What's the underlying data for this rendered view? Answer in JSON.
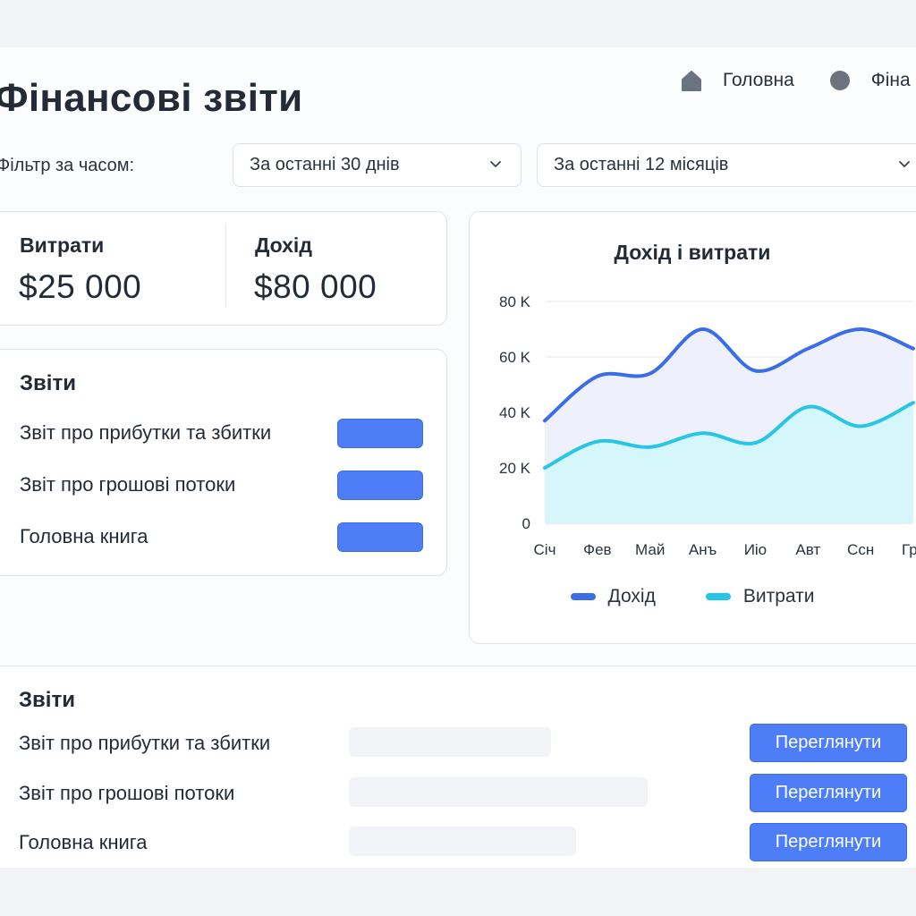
{
  "page_title": "Фінансові звіти",
  "nav": {
    "home_label": "Головна",
    "finance_label": "Фіна",
    "home_icon": "home-icon",
    "finance_icon": "circle-icon"
  },
  "filter": {
    "label": "Фільтр за часом:",
    "select_1": "За останні 30  днів",
    "select_2": "За останні 12 місяців"
  },
  "metrics": {
    "expenses_label": "Витрати",
    "expenses_value": "$25 000",
    "income_label": "Дохід",
    "income_value": "$80 000"
  },
  "reports_card": {
    "title": "Звіти",
    "items": [
      "Звіт про прибутки та збитки",
      "Звіт про грошові потоки",
      "Головна книга"
    ]
  },
  "chart_data": {
    "type": "area",
    "title": "Дохід і витрати",
    "categories": [
      "Січ",
      "Фев",
      "Май",
      "Анъ",
      "Иiо",
      "Авт",
      "Ссн",
      "Гру"
    ],
    "yticks": [
      "0",
      "20 K",
      "40 K",
      "60 K",
      "80 K"
    ],
    "ylim": [
      0,
      80000
    ],
    "grid": true,
    "legend_position": "bottom",
    "series": [
      {
        "name": "Дохід",
        "color": "#3b6ee6",
        "values": [
          37000,
          53000,
          54000,
          70000,
          55000,
          63000,
          70000,
          63000
        ]
      },
      {
        "name": "Витрати",
        "color": "#27c6e6",
        "values": [
          20000,
          29500,
          27500,
          32500,
          29000,
          42000,
          35000,
          43500
        ]
      }
    ]
  },
  "bottom_reports": {
    "title": "Звіти",
    "items": [
      "Звіт про прибутки та збитки",
      "Звіт про грошові потоки",
      "Головна книга"
    ],
    "button_label": "Переглянути"
  },
  "colors": {
    "accent": "#4d7ef7",
    "income": "#3b6ee6",
    "expenses": "#27c6e6"
  }
}
